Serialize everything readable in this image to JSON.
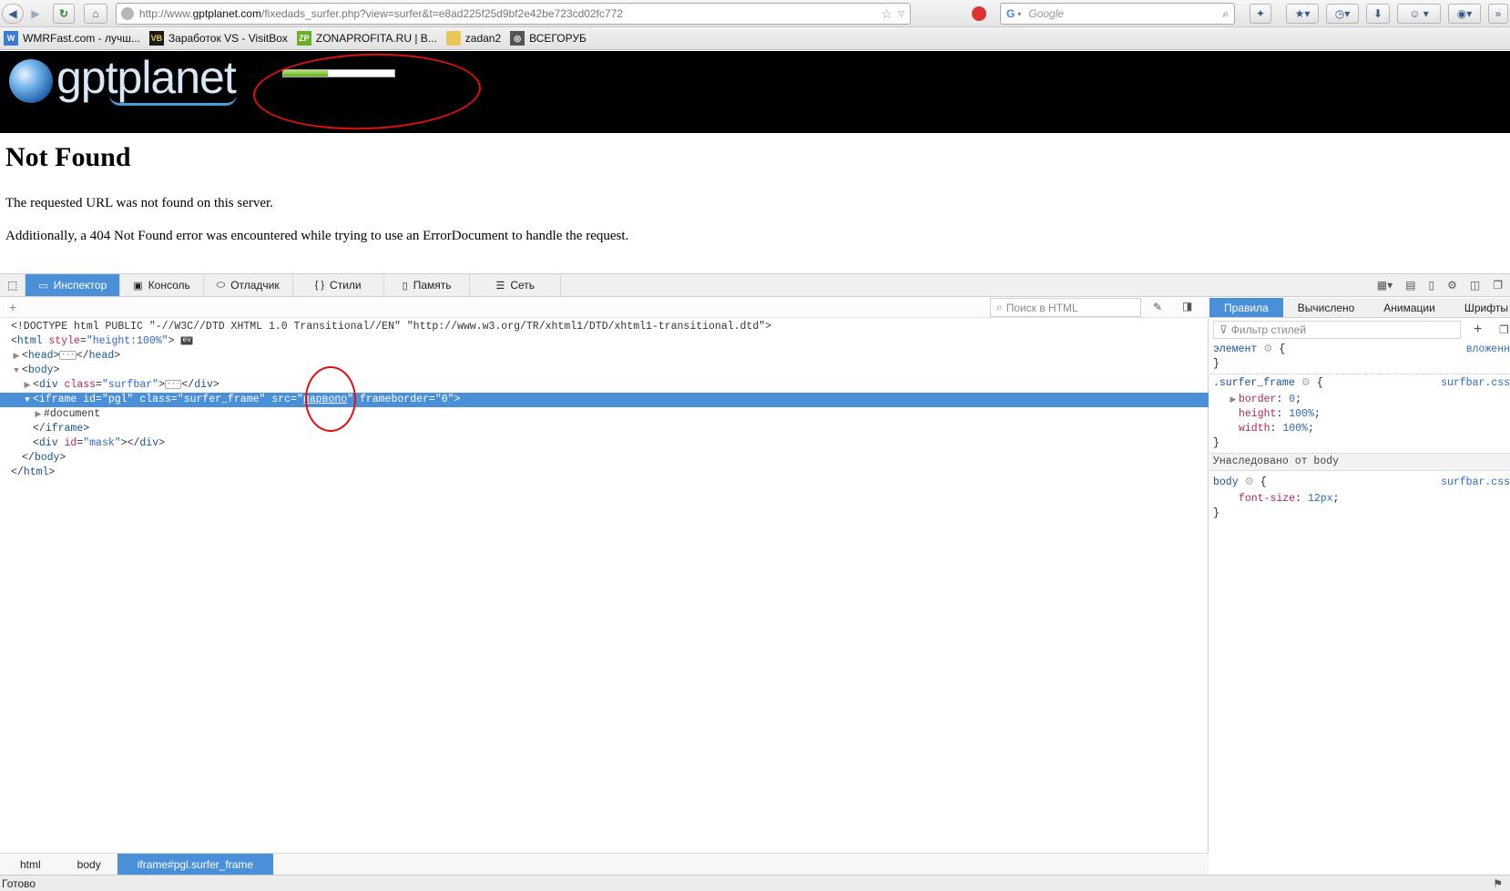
{
  "browser": {
    "url_prefix": "http://www.",
    "url_domain": "gptplanet.com",
    "url_path": "/fixedads_surfer.php?view=surfer&t=e8ad225f25d9bf2e42be723cd02fc772",
    "search_engine_placeholder": "Google"
  },
  "bookmarks": [
    {
      "label": "WMRFast.com - лучш...",
      "icon": "wmr-icon",
      "color": "#3b7bd1",
      "glyph": "W"
    },
    {
      "label": "Заработок VS - VisitBox",
      "icon": "visitbox-icon",
      "color": "#1a1a1a",
      "glyph": "VB"
    },
    {
      "label": "ZONAPROFITA.RU | В...",
      "icon": "zonaprofita-icon",
      "color": "#6aae2a",
      "glyph": "ZP"
    },
    {
      "label": "zadan2",
      "icon": "folder-icon",
      "color": "#e9c65a",
      "glyph": ""
    },
    {
      "label": "ВСЕГОРУБ",
      "icon": "vsegorub-icon",
      "color": "#555555",
      "glyph": "◎"
    }
  ],
  "page": {
    "logo_text": "gptplanet",
    "progress_fraction": 0.4,
    "heading": "Not Found",
    "p1": "The requested URL was not found on this server.",
    "p2": "Additionally, a 404 Not Found error was encountered while trying to use an ErrorDocument to handle the request."
  },
  "devtools": {
    "tabs": [
      {
        "label": "Инспектор",
        "icon": "inspector-icon",
        "glyph": "▭",
        "selected": true
      },
      {
        "label": "Консоль",
        "icon": "console-icon",
        "glyph": "▣",
        "selected": false
      },
      {
        "label": "Отладчик",
        "icon": "debugger-icon",
        "glyph": "⬭",
        "selected": false
      },
      {
        "label": "Стили",
        "icon": "styles-icon",
        "glyph": "{ }",
        "selected": false
      },
      {
        "label": "Память",
        "icon": "memory-icon",
        "glyph": "▯",
        "selected": false
      },
      {
        "label": "Сеть",
        "icon": "network-icon",
        "glyph": "☰",
        "selected": false
      }
    ],
    "html_search_placeholder": "Поиск в HTML",
    "markup": {
      "doctype": "<!DOCTYPE html PUBLIC \"-//W3C//DTD XHTML 1.0 Transitional//EN\" \"http://www.w3.org/TR/xhtml1/DTD/xhtml1-transitional.dtd\">",
      "html_tag": "html",
      "html_attr": "style",
      "html_attr_val": "\"height:100%\"",
      "ev_badge": "ev",
      "head_tag": "head",
      "body_tag": "body",
      "div_tag": "div",
      "class_attr": "class",
      "surfbar_val": "\"surfbar\"",
      "iframe_tag": "iframe",
      "id_attr": "id",
      "pgl_val": "\"pgl\"",
      "surfer_frame_val": "\"surfer_frame\"",
      "src_attr": "src",
      "src_val": "парвопо",
      "frameborder_attr": "frameborder",
      "frameborder_val": "\"0\"",
      "document_node": "#document",
      "mask_val": "\"mask\""
    },
    "breadcrumbs": [
      "html",
      "body",
      "iframe#pgl.surfer_frame"
    ],
    "rules_tabs": [
      "Правила",
      "Вычислено",
      "Анимации",
      "Шрифты"
    ],
    "filter_placeholder": "Фильтр стилей",
    "rules": {
      "element_selector": "элемент",
      "element_source": "вложенн",
      "rule1_selector": ".surfer_frame",
      "rule1_source": "surfbar.css",
      "rule1_props": [
        {
          "name": "border",
          "value": "0"
        },
        {
          "name": "height",
          "value": "100%"
        },
        {
          "name": "width",
          "value": "100%"
        }
      ],
      "inherited_label": "Унаследовано от body",
      "rule2_selector": "body",
      "rule2_source": "surfbar.css",
      "rule2_prop": "font-size",
      "rule2_value": "12px"
    }
  },
  "status": {
    "text": "Готово"
  }
}
